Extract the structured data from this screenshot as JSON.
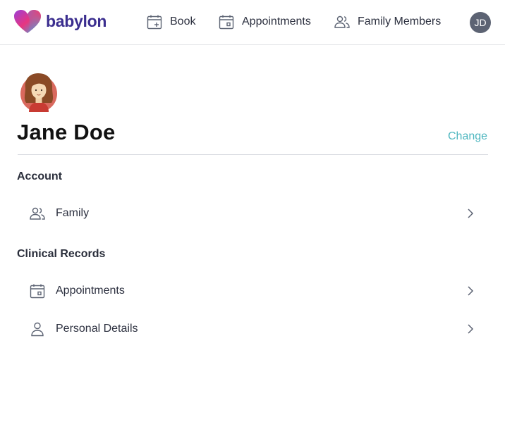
{
  "brand": {
    "name": "babylon",
    "colors": {
      "heart_left": "#8e3fd6",
      "heart_right": "#f0337a",
      "heart_bottom": "#2db4e8",
      "wordmark": "#3b2e8f"
    }
  },
  "nav": {
    "book": {
      "label": "Book",
      "icon": "calendar-plus-icon"
    },
    "appointments": {
      "label": "Appointments",
      "icon": "calendar-icon"
    },
    "family_members": {
      "label": "Family Members",
      "icon": "people-icon"
    }
  },
  "user": {
    "initials": "JD",
    "name": "Jane Doe"
  },
  "profile": {
    "change_label": "Change",
    "accent": "#4db6bf"
  },
  "sections": {
    "account": {
      "title": "Account",
      "items": [
        {
          "label": "Family",
          "icon": "people-icon"
        }
      ]
    },
    "clinical": {
      "title": "Clinical Records",
      "items": [
        {
          "label": "Appointments",
          "icon": "calendar-icon"
        },
        {
          "label": "Personal Details",
          "icon": "person-icon"
        }
      ]
    }
  }
}
